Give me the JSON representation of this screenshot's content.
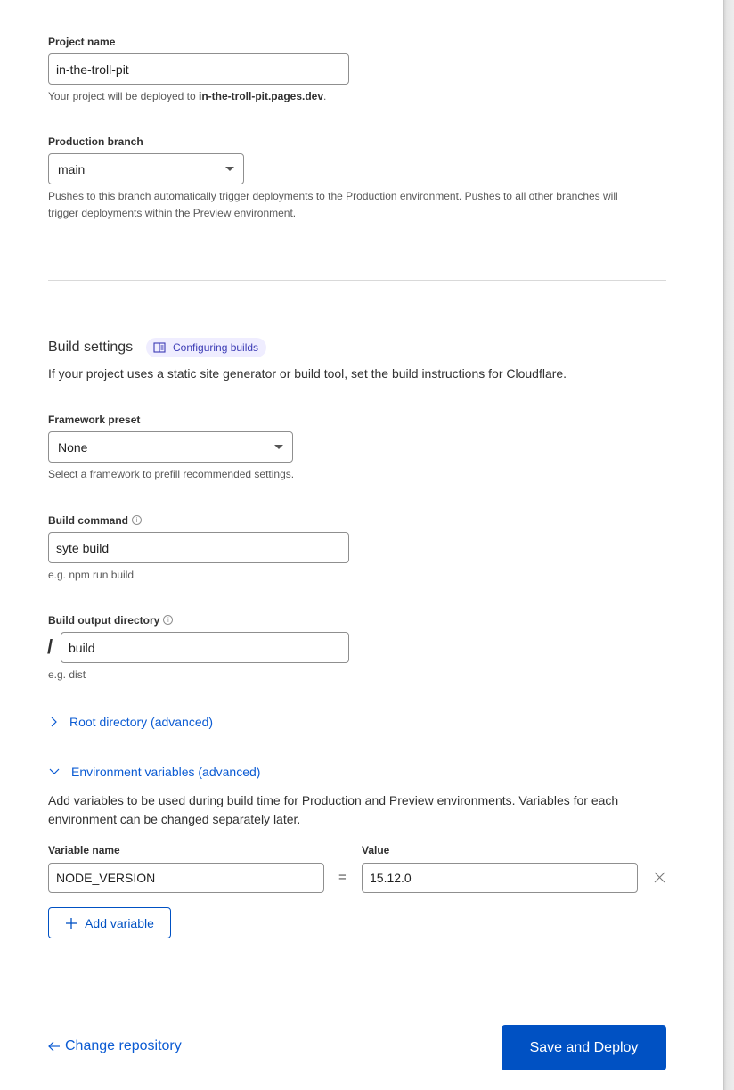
{
  "project": {
    "label": "Project name",
    "value": "in-the-troll-pit",
    "help_prefix": "Your project will be deployed to ",
    "help_domain": "in-the-troll-pit.pages.dev",
    "help_suffix": "."
  },
  "branch": {
    "label": "Production branch",
    "selected": "main",
    "help": "Pushes to this branch automatically trigger deployments to the Production environment. Pushes to all other branches will trigger deployments within the Preview environment."
  },
  "build_settings": {
    "title": "Build settings",
    "docs_pill": "Configuring builds",
    "description": "If your project uses a static site generator or build tool, set the build instructions for Cloudflare.",
    "framework": {
      "label": "Framework preset",
      "selected": "None",
      "help": "Select a framework to prefill recommended settings."
    },
    "command": {
      "label": "Build command",
      "value": "syte build",
      "help": "e.g. npm run build"
    },
    "output": {
      "label": "Build output directory",
      "prefix": "/",
      "value": "build",
      "help": "e.g. dist"
    },
    "root_directory_toggle": "Root directory (advanced)",
    "env_toggle": "Environment variables (advanced)",
    "env_description": "Add variables to be used during build time for Production and Preview environments. Variables for each environment can be changed separately later.",
    "env_vars": {
      "name_header": "Variable name",
      "value_header": "Value",
      "equals": "=",
      "rows": [
        {
          "name": "NODE_VERSION",
          "value": "15.12.0"
        }
      ],
      "add_label": "Add variable"
    }
  },
  "footer": {
    "back_label": "Change repository",
    "submit_label": "Save and Deploy"
  },
  "colors": {
    "primary": "#0051c3",
    "link": "#0b5bd3",
    "pill_bg": "#efedff",
    "pill_text": "#3b3bb5"
  }
}
